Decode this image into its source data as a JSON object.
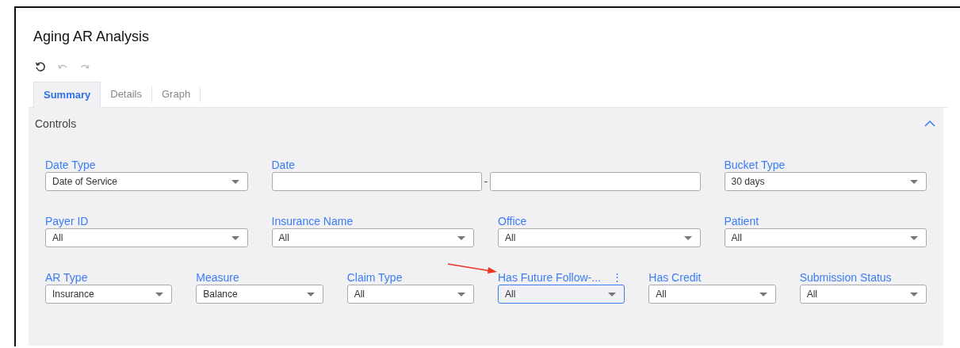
{
  "title": "Aging AR Analysis",
  "tabs": [
    {
      "label": "Summary",
      "selected": true
    },
    {
      "label": "Details",
      "selected": false
    },
    {
      "label": "Graph",
      "selected": false
    }
  ],
  "controls": {
    "title": "Controls",
    "expanded": true,
    "rows": [
      {
        "fields": [
          {
            "kind": "select",
            "label": "Date Type",
            "value": "Date of Service",
            "focused": false
          },
          {
            "kind": "daterange",
            "label": "Date"
          },
          {
            "kind": "select",
            "label": "Bucket Type",
            "value": "30 days",
            "focused": false
          }
        ]
      },
      {
        "fields": [
          {
            "kind": "select",
            "label": "Payer ID",
            "value": "All",
            "focused": false
          },
          {
            "kind": "select",
            "label": "Insurance Name",
            "value": "All",
            "focused": false
          },
          {
            "kind": "select",
            "label": "Office",
            "value": "All",
            "focused": false
          },
          {
            "kind": "select",
            "label": "Patient",
            "value": "All",
            "focused": false
          }
        ]
      },
      {
        "fields": [
          {
            "kind": "select",
            "label": "AR Type",
            "value": "Insurance",
            "focused": false
          },
          {
            "kind": "select",
            "label": "Measure",
            "value": "Balance",
            "focused": false
          },
          {
            "kind": "select",
            "label": "Claim Type",
            "value": "All",
            "focused": false
          },
          {
            "kind": "select",
            "label": "Has Future Follow-...",
            "value": "All",
            "focused": true,
            "menu": "⋮"
          },
          {
            "kind": "select",
            "label": "Has Credit",
            "value": "All",
            "focused": false
          },
          {
            "kind": "select",
            "label": "Submission Status",
            "value": "All",
            "focused": false
          }
        ]
      }
    ]
  }
}
